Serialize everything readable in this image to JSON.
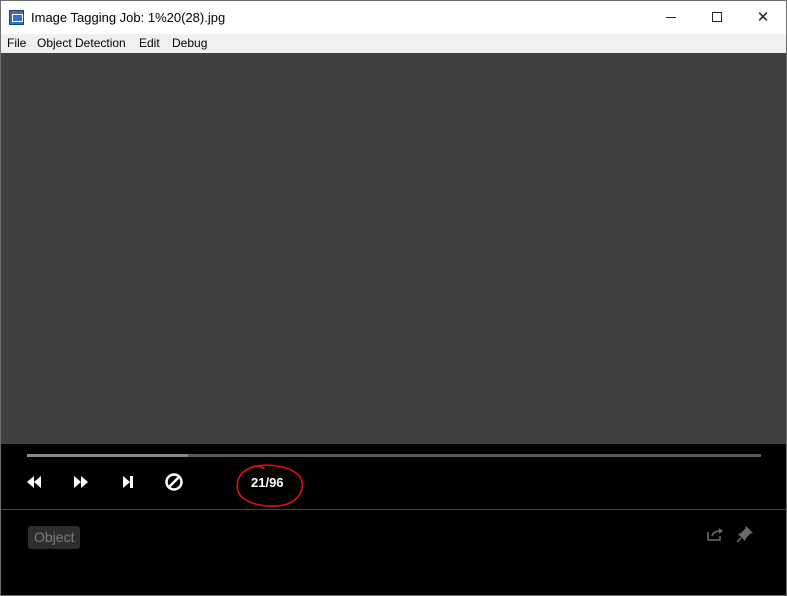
{
  "window": {
    "title": "Image Tagging Job: 1%20(28).jpg",
    "controls": {
      "minimize": "minimize-icon",
      "maximize": "maximize-icon",
      "close": "close-icon"
    }
  },
  "menu": {
    "items": [
      "File",
      "Object Detection",
      "Edit",
      "Debug"
    ]
  },
  "player": {
    "progress_fraction": 0.21875,
    "counter": "21/96",
    "buttons": [
      "rewind-icon",
      "fast-forward-icon",
      "skip-next-icon",
      "block-icon"
    ]
  },
  "tags": {
    "chip_label": "Object"
  },
  "colors": {
    "viewer_background": "#404040",
    "annotation": "#e01010"
  }
}
